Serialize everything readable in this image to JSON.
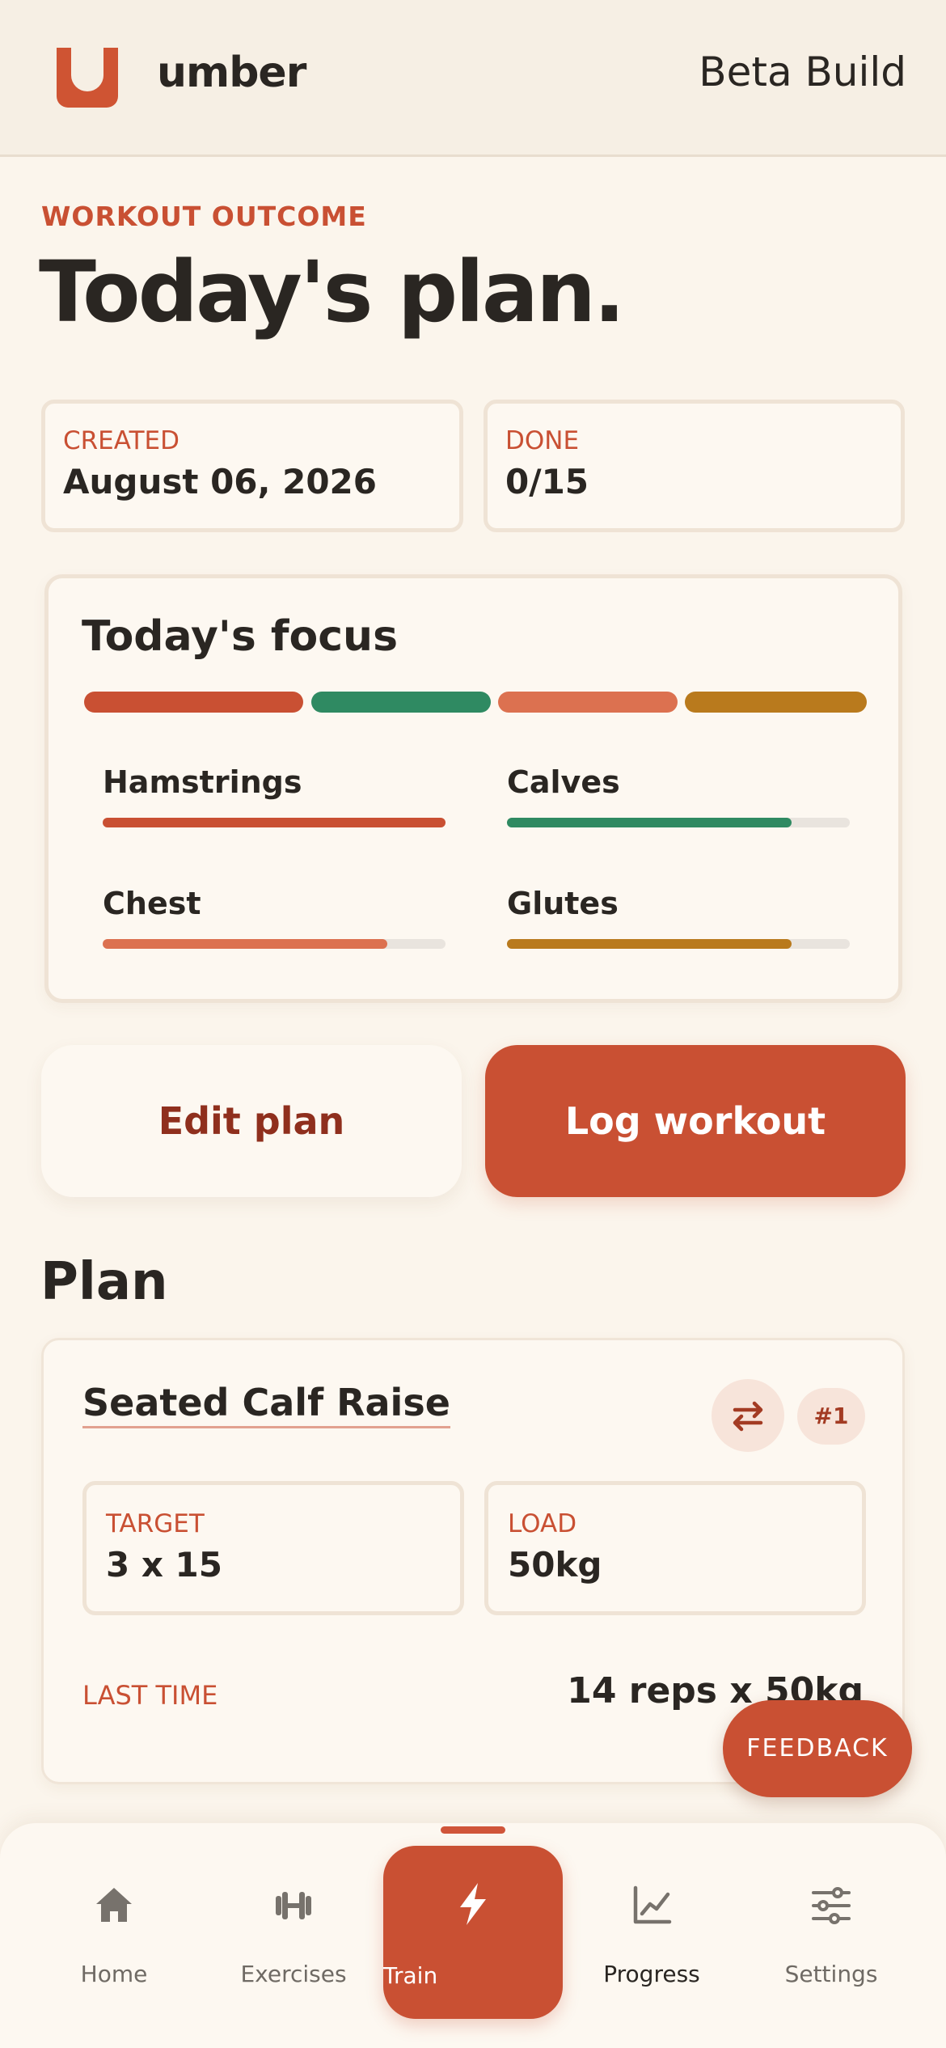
{
  "header": {
    "brand": "umber",
    "build_label": "Beta Build",
    "brand_color": "#c95033"
  },
  "page": {
    "eyebrow": "WORKOUT OUTCOME",
    "title": "Today's plan."
  },
  "stats": {
    "created_label": "CREATED",
    "created_value": "August 06, 2026",
    "done_label": "DONE",
    "done_value": "0/15"
  },
  "focus": {
    "title": "Today's focus",
    "segment_colors": [
      "#c95033",
      "#2f8a62",
      "#dc7150",
      "#b97a1d"
    ],
    "muscles": [
      {
        "name": "Hamstrings",
        "level": 1.0,
        "color": "#c95033"
      },
      {
        "name": "Calves",
        "level": 0.83,
        "color": "#2f8a62"
      },
      {
        "name": "Chest",
        "level": 0.83,
        "color": "#dc7150"
      },
      {
        "name": "Glutes",
        "level": 0.83,
        "color": "#b97a1d"
      }
    ]
  },
  "actions": {
    "edit_label": "Edit plan",
    "log_label": "Log workout"
  },
  "plan": {
    "section_title": "Plan",
    "exercise": {
      "name": "Seated Calf Raise",
      "swap_icon": "swap-arrows-icon",
      "rank": "#1",
      "target_label": "TARGET",
      "target_value": "3 x 15",
      "load_label": "LOAD",
      "load_value": "50kg",
      "last_label": "LAST TIME",
      "last_value": "14 reps x 50kg"
    }
  },
  "feedback_label": "FEEDBACK",
  "nav": {
    "items": [
      {
        "label": "Home",
        "icon": "home-icon"
      },
      {
        "label": "Exercises",
        "icon": "dumbbell-icon"
      },
      {
        "label": "Train",
        "icon": "lightning-icon",
        "active": true
      },
      {
        "label": "Progress",
        "icon": "chart-line-icon"
      },
      {
        "label": "Settings",
        "icon": "sliders-icon"
      }
    ]
  }
}
